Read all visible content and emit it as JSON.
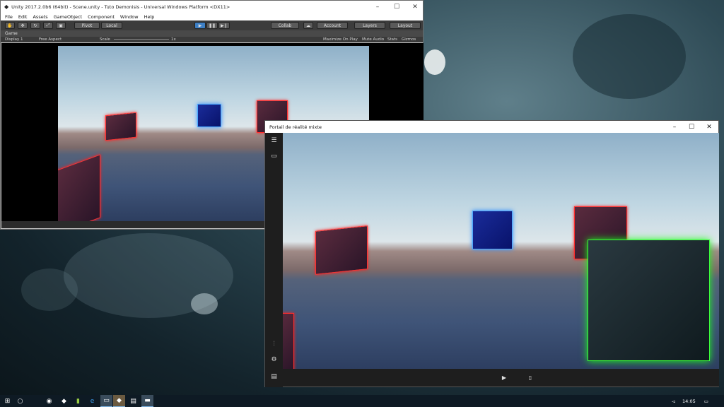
{
  "unity": {
    "title": "Unity 2017.2.0b6 (64bit) - Scene.unity - Tuto Demonisis - Universal Windows Platform <DX11>",
    "menu": [
      "File",
      "Edit",
      "Assets",
      "GameObject",
      "Component",
      "Window",
      "Help"
    ],
    "toolbar": {
      "pivot": "Pivot",
      "local": "Local",
      "collab": "Collab",
      "account": "Account",
      "layers": "Layers",
      "layout": "Layout"
    },
    "game_tab": "Game",
    "game_controls": {
      "display": "Display 1",
      "aspect": "Free Aspect",
      "scale": "Scale",
      "scale_value": "1x",
      "maximize": "Maximize On Play",
      "mute": "Mute Audio",
      "stats": "Stats",
      "gizmos": "Gizmos"
    }
  },
  "portal": {
    "title": "Portail de réalité mixte"
  },
  "taskbar": {
    "clock": "14:05"
  },
  "colors": {
    "unity_dark": "#3c3c3c",
    "play_blue": "#3d7fc4",
    "cube_red": "#ff2e2e",
    "cube_blue": "#4aa8ff",
    "cube_green": "#3cff3c",
    "taskbar": "#0e1a24"
  }
}
